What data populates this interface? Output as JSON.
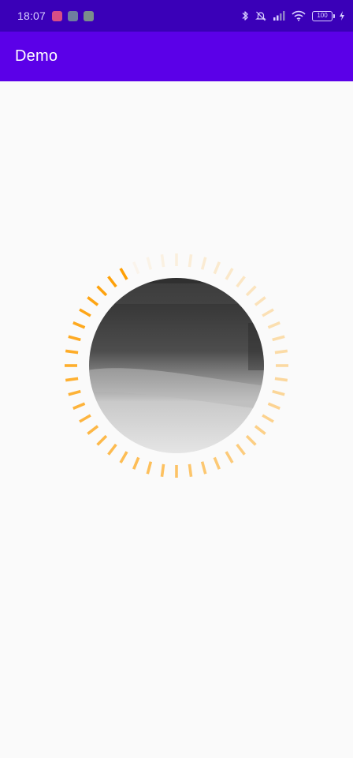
{
  "status_bar": {
    "time": "18:07",
    "battery": "100",
    "notification_icons": [
      "video-app-icon",
      "app-icon",
      "app-icon"
    ],
    "system_icons": [
      "bluetooth-icon",
      "mute-icon",
      "signal-icon",
      "wifi-icon",
      "battery-icon",
      "charging-icon"
    ]
  },
  "app_bar": {
    "title": "Demo",
    "color": "#5b00e8"
  },
  "loader": {
    "accent_color": "#ff9e00"
  }
}
